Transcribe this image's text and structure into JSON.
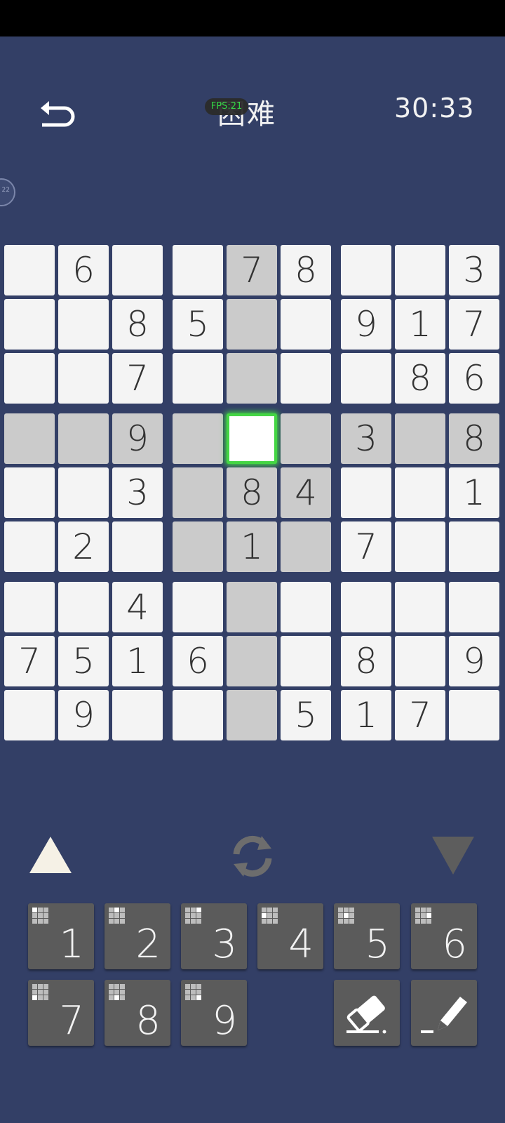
{
  "header": {
    "title": "困难",
    "fps_badge": "FPS:21",
    "timer": "30:33",
    "side_badge": "22"
  },
  "board": [
    [
      null,
      6,
      null,
      null,
      7,
      8,
      null,
      null,
      3
    ],
    [
      null,
      null,
      8,
      5,
      null,
      null,
      9,
      1,
      7
    ],
    [
      null,
      null,
      7,
      null,
      null,
      null,
      null,
      8,
      6
    ],
    [
      null,
      null,
      9,
      null,
      null,
      null,
      3,
      null,
      8
    ],
    [
      null,
      null,
      3,
      null,
      8,
      4,
      null,
      null,
      1
    ],
    [
      null,
      2,
      null,
      null,
      1,
      null,
      7,
      null,
      null
    ],
    [
      null,
      null,
      4,
      null,
      null,
      null,
      null,
      null,
      null
    ],
    [
      7,
      5,
      1,
      6,
      null,
      null,
      8,
      null,
      9
    ],
    [
      null,
      9,
      null,
      null,
      null,
      5,
      1,
      7,
      null
    ]
  ],
  "selected": {
    "row": 3,
    "col": 4
  },
  "keypad": {
    "digits": [
      "1",
      "2",
      "3",
      "4",
      "5",
      "6",
      "7",
      "8",
      "9"
    ],
    "tools": [
      "eraser",
      "pencil"
    ]
  },
  "colors": {
    "background": "#333F66",
    "cell": "#F4F4F4",
    "highlight": "#CBCBCB",
    "selected_border": "#44D544",
    "key": "#5B5B5B"
  },
  "icons": {
    "back": "undo-arrow-icon",
    "up": "triangle-up-icon",
    "refresh": "refresh-icon",
    "down": "triangle-down-icon",
    "eraser": "eraser-icon",
    "pencil": "pencil-icon"
  }
}
